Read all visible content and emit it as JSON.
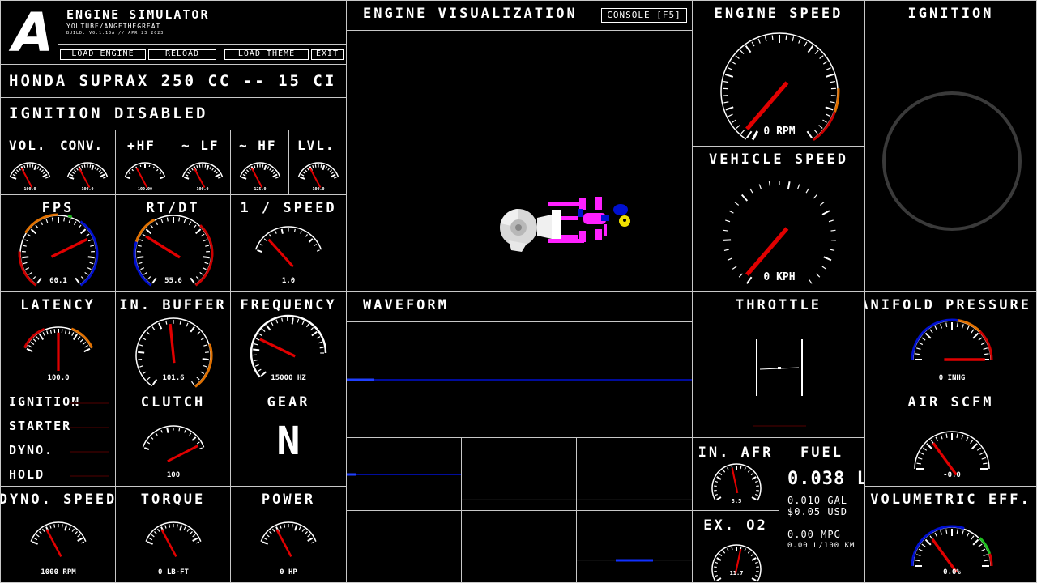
{
  "header": {
    "logo_letter": "A",
    "app_title": "ENGINE SIMULATOR",
    "subtitle": "YOUTUBE/ANGETHEGREAT",
    "build": "BUILD: V0.1.10A // APR 23 2023",
    "buttons": [
      "LOAD ENGINE",
      "RELOAD",
      "LOAD THEME",
      "EXIT"
    ]
  },
  "engine_name": "HONDA SUPRAX 250 CC -- 15 CI",
  "ignition_status": "IGNITION DISABLED",
  "viz": {
    "title": "ENGINE VISUALIZATION",
    "console_button": "CONSOLE [F5]"
  },
  "small_gauges": [
    {
      "title": "VOL.",
      "readout": "100.0"
    },
    {
      "title": "CONV.",
      "readout": "100.0"
    },
    {
      "title": "+HF",
      "readout": "100.00"
    },
    {
      "title": "~ LF",
      "readout": "100.0"
    },
    {
      "title": "~ HF",
      "readout": "125.0"
    },
    {
      "title": "LVL.",
      "readout": "100.0"
    }
  ],
  "perf_gauges": [
    {
      "title": "FPS",
      "readout": "60.1",
      "level": 0.72
    },
    {
      "title": "RT/DT",
      "readout": "55.6",
      "level": 0.3
    },
    {
      "title": "1 / SPEED",
      "readout": "1.0",
      "level": 0.2
    }
  ],
  "latency": {
    "title": "LATENCY",
    "readout": "100.0"
  },
  "in_buffer": {
    "title": "IN. BUFFER",
    "readout": "101.6"
  },
  "frequency": {
    "title": "FREQUENCY",
    "readout": "15000 HZ"
  },
  "waveform": {
    "title": "WAVEFORM"
  },
  "indicators": [
    {
      "label": "IGNITION"
    },
    {
      "label": "STARTER"
    },
    {
      "label": "DYNO."
    },
    {
      "label": "HOLD"
    }
  ],
  "clutch": {
    "title": "CLUTCH",
    "readout": "100",
    "level": 0.95
  },
  "gear": {
    "title": "GEAR",
    "value": "N"
  },
  "bottom_gauges": [
    {
      "title": "DYNO. SPEED",
      "readout": "1000 RPM"
    },
    {
      "title": "TORQUE",
      "readout": "0 LB-FT"
    },
    {
      "title": "POWER",
      "readout": "0 HP"
    }
  ],
  "engine_speed": {
    "title": "ENGINE SPEED",
    "readout": "0 RPM",
    "value": 0
  },
  "vehicle_speed": {
    "title": "VEHICLE SPEED",
    "readout": "0 KPH",
    "value": 0
  },
  "ignition_panel": {
    "title": "IGNITION"
  },
  "throttle": {
    "title": "THROTTLE"
  },
  "manifold": {
    "title": "MANIFOLD PRESSURE",
    "readout": "0 INHG"
  },
  "air": {
    "title": "AIR SCFM",
    "readout": "-0.0"
  },
  "in_afr": {
    "title": "IN. AFR",
    "readout": "8.5"
  },
  "ex_o2": {
    "title": "EX. O2",
    "readout": "11.7"
  },
  "fuel": {
    "title": "FUEL",
    "liters": "0.038 L",
    "gallons": "0.010 GAL",
    "cost": "$0.05 USD",
    "mpg": "0.00 MPG",
    "l100": "0.00 L/100 KM"
  },
  "volumetric": {
    "title": "VOLUMETRIC EFF.",
    "readout": "0.0%"
  },
  "colors": {
    "needle": "#e00000",
    "arc_red": "#cc0000",
    "arc_orange": "#e07000",
    "arc_blue": "#0010d0",
    "arc_green": "#20c020",
    "wave": "#1010ff"
  }
}
